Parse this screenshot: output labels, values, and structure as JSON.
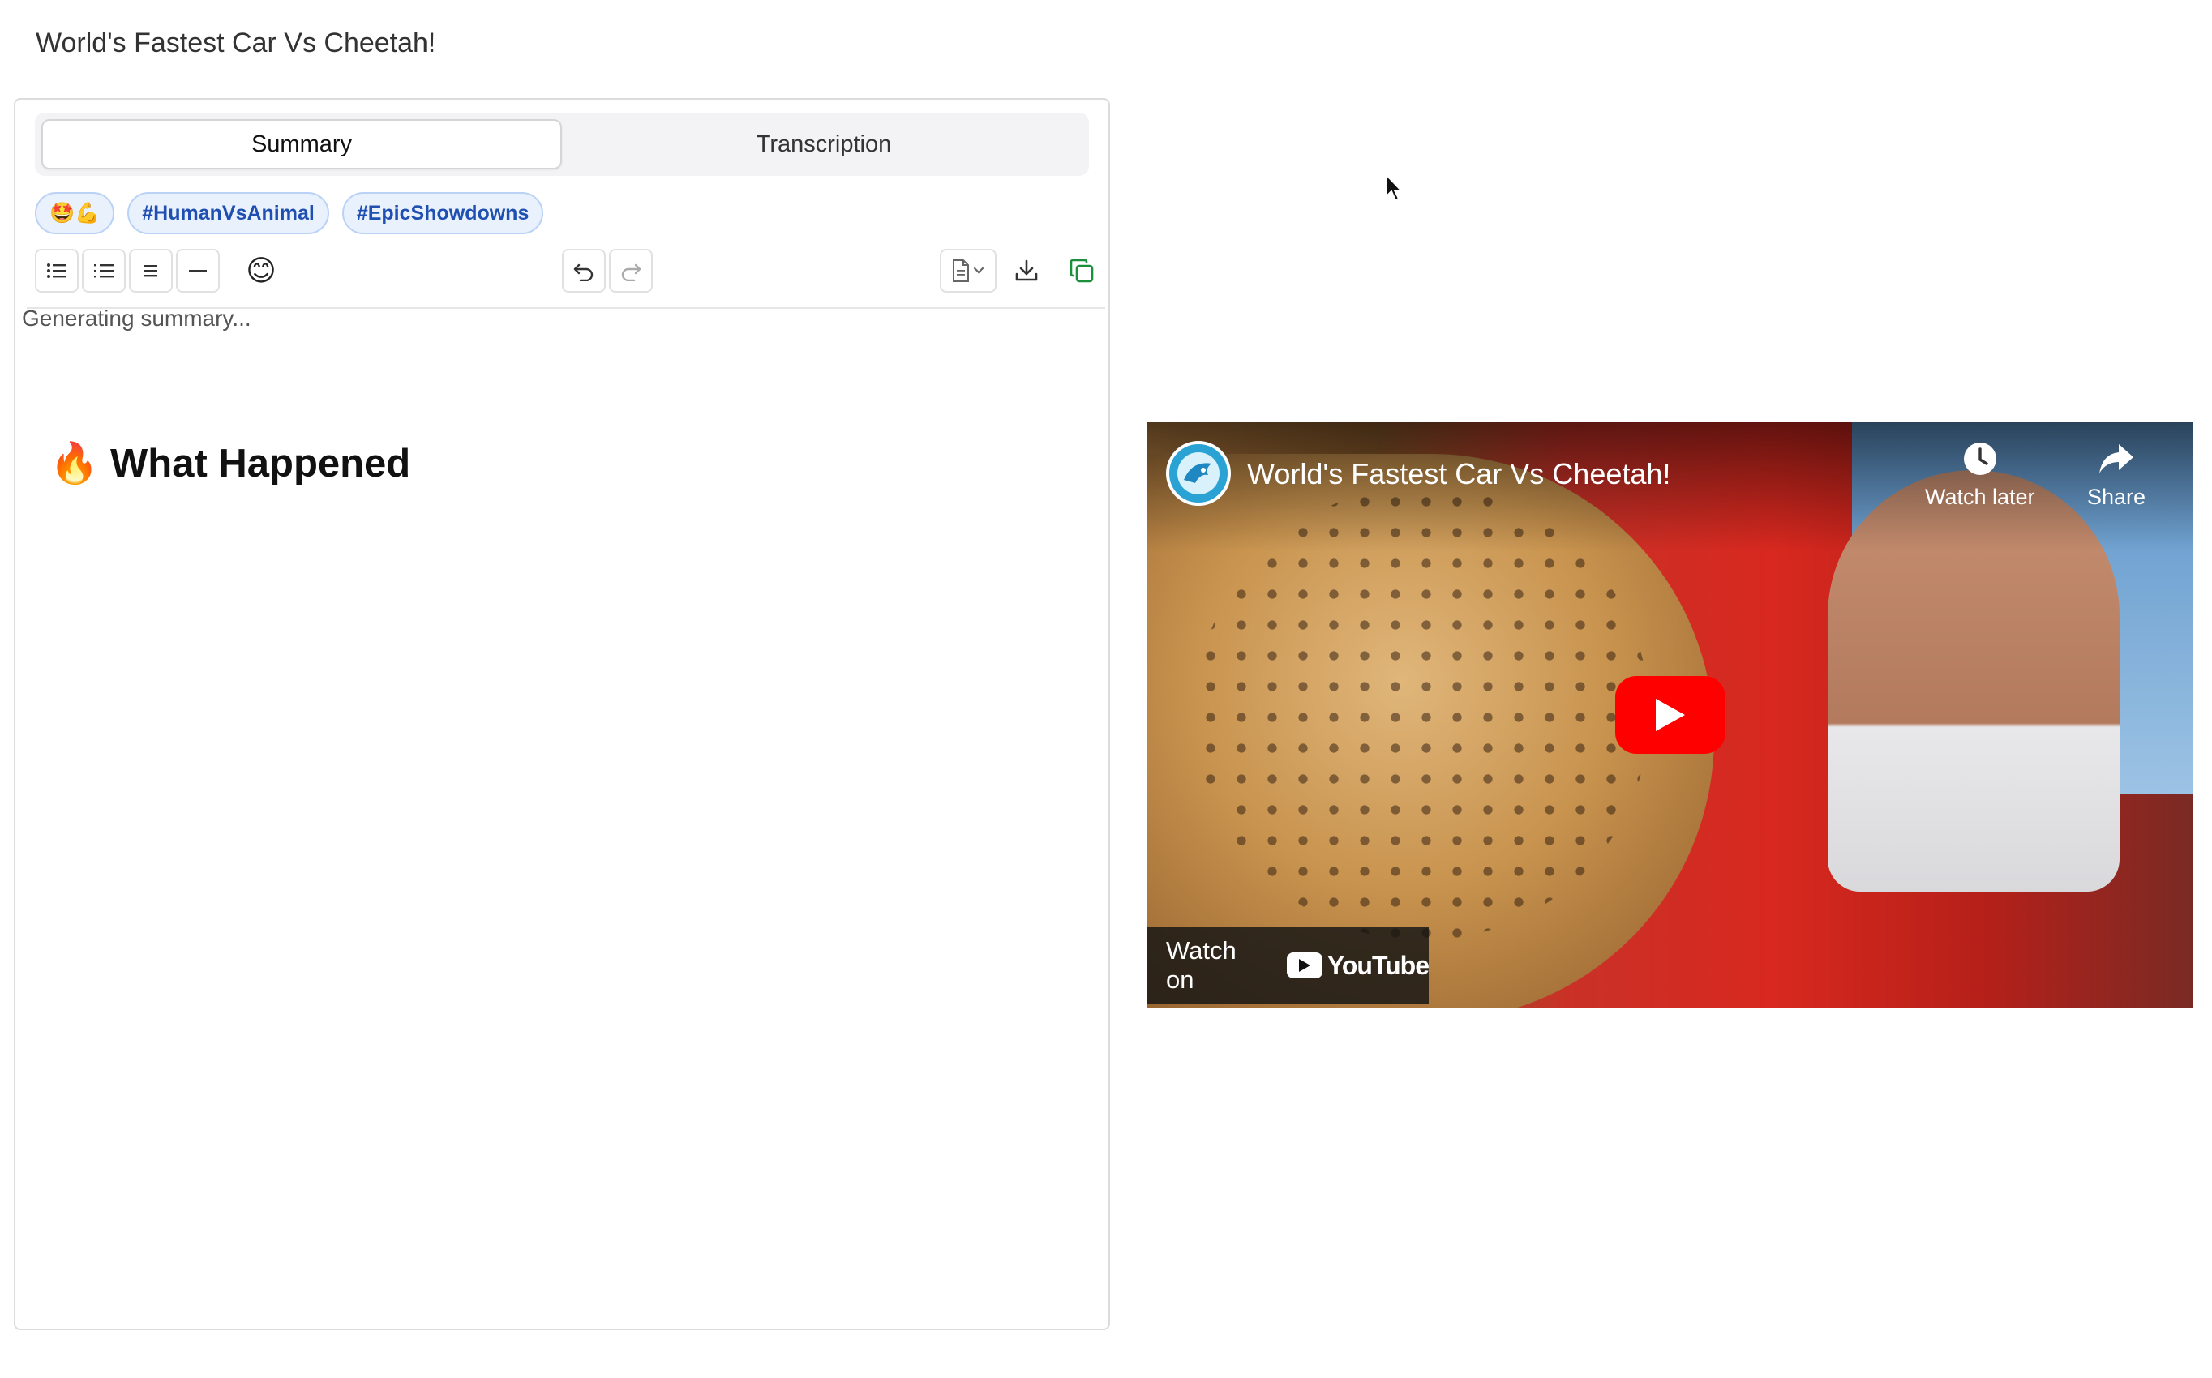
{
  "page": {
    "title": "World's Fastest Car Vs Cheetah!"
  },
  "tabs": [
    {
      "label": "Summary",
      "active": true
    },
    {
      "label": "Transcription",
      "active": false
    }
  ],
  "tags": [
    "🤩💪",
    "#HumanVsAnimal",
    "#EpicShowdowns"
  ],
  "toolbar": {
    "buttons": [
      "bulleted-list-icon",
      "numbered-list-icon",
      "align-icon",
      "horizontal-rule-icon",
      "emoji-icon",
      "undo-icon",
      "redo-icon",
      "document-template-icon",
      "download-icon",
      "copy-icon"
    ],
    "emoji": "😊"
  },
  "content": {
    "status": "Generating summary...",
    "heading_emoji": "🔥",
    "heading": "What Happened"
  },
  "video": {
    "title": "World's Fastest Car Vs Cheetah!",
    "watch_later": "Watch later",
    "share": "Share",
    "watch_on": "Watch on",
    "youtube": "YouTube",
    "colors": {
      "play": "#ff0000",
      "accent_green": "#1a8f3c"
    }
  }
}
